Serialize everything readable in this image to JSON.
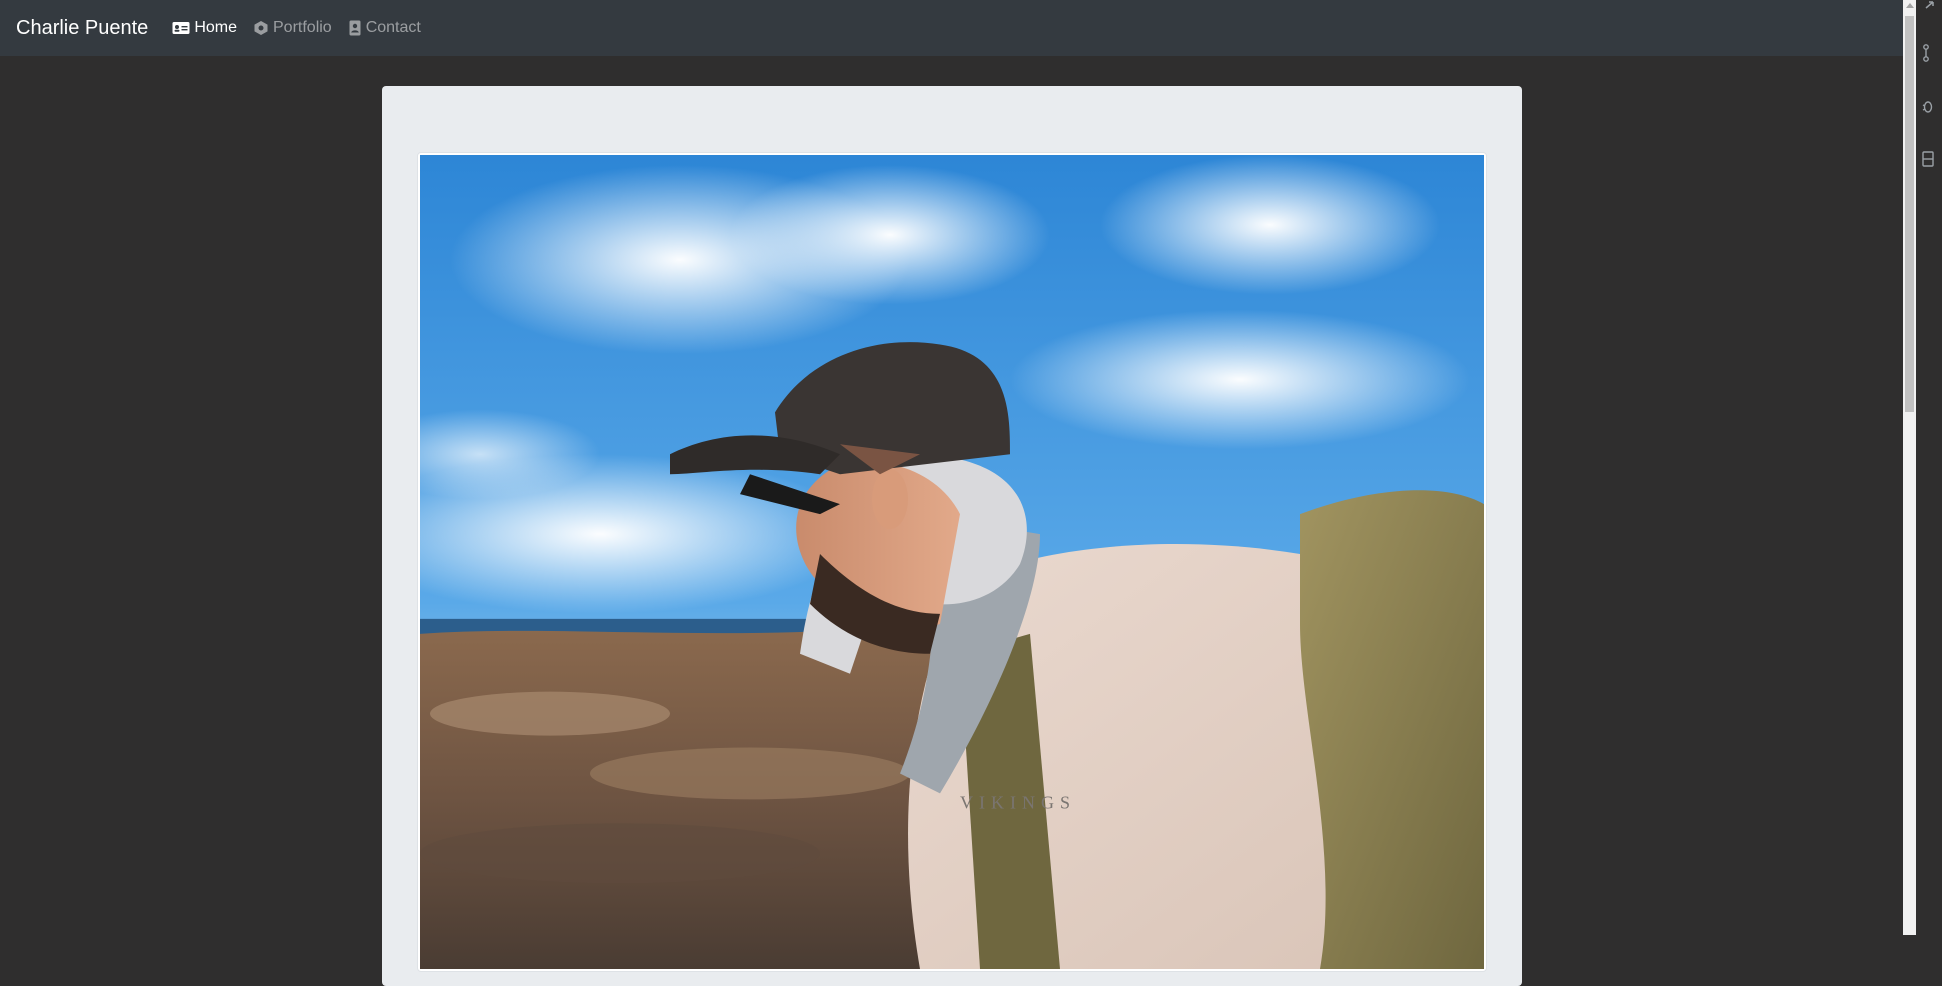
{
  "navbar": {
    "brand": "Charlie Puente",
    "links": [
      {
        "label": "Home",
        "icon": "id-card-icon",
        "active": true
      },
      {
        "label": "Portfolio",
        "icon": "hexagon-icon",
        "active": false
      },
      {
        "label": "Contact",
        "icon": "contact-book-icon",
        "active": false
      }
    ]
  },
  "colors": {
    "navbar_bg": "#343a40",
    "page_bg": "#2f2e2e",
    "jumbotron_bg": "#e9ecef",
    "active_link": "#ffffff",
    "inactive_link": "rgba(255,255,255,0.5)"
  },
  "main": {
    "photo": {
      "subject": "profile-photo",
      "shirt_text": "VIKINGS"
    }
  }
}
